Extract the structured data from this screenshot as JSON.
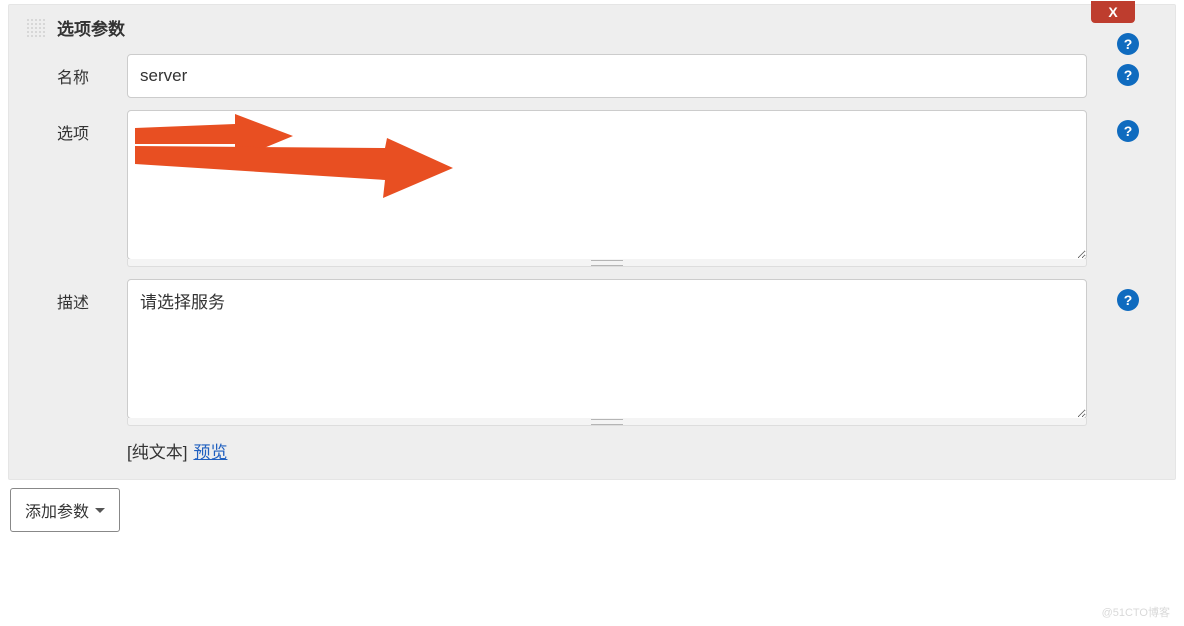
{
  "header": {
    "title": "选项参数",
    "close_label": "X"
  },
  "fields": {
    "name_label": "名称",
    "name_value": "server",
    "options_label": "选项",
    "options_value": "",
    "description_label": "描述",
    "description_value": "请选择服务"
  },
  "format": {
    "plain_text": "[纯文本]",
    "preview": "预览"
  },
  "footer": {
    "add_param": "添加参数"
  },
  "watermark": "@51CTO博客",
  "icons": {
    "help": "?",
    "caret": "chevron-down-icon"
  },
  "colors": {
    "panel_bg": "#eeeeee",
    "close_bg": "#be3d2e",
    "help_bg": "#0f6bbf",
    "arrow": "#e84f22",
    "link": "#2060c0"
  }
}
